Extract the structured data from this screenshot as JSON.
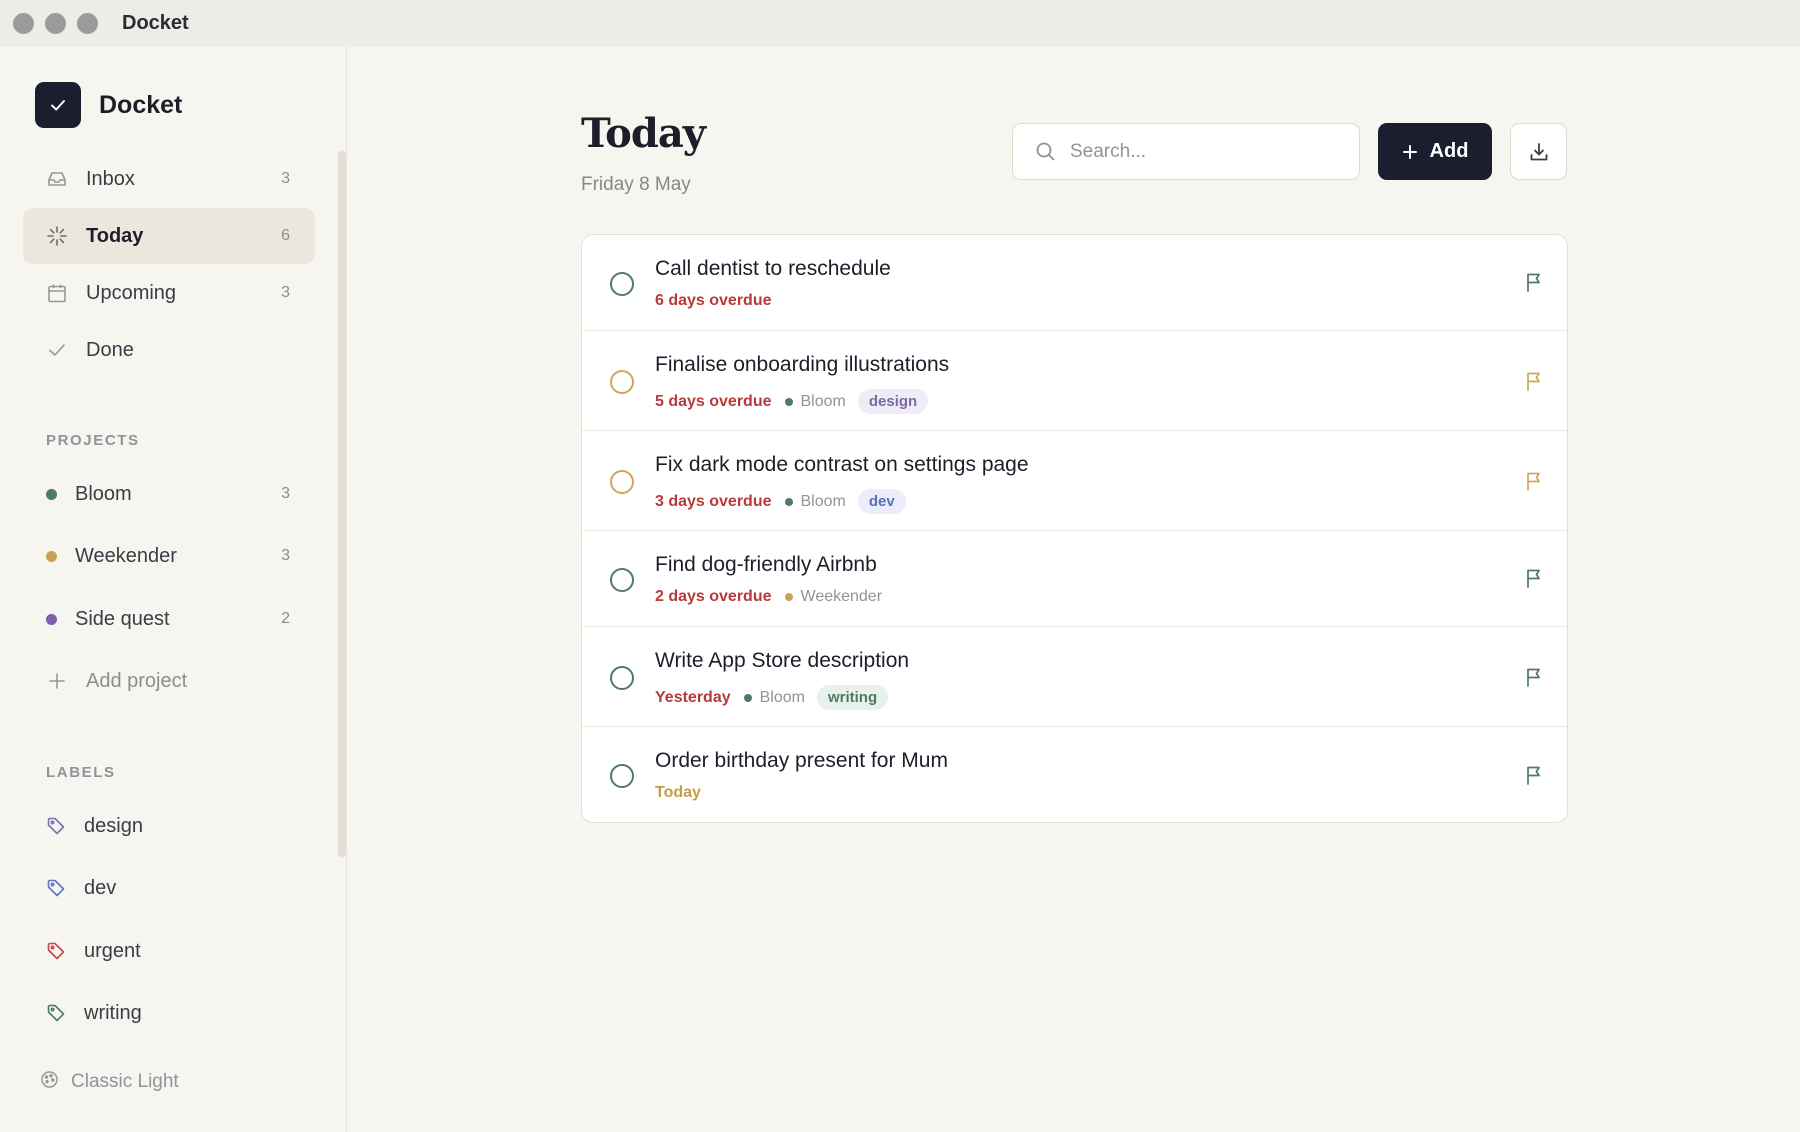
{
  "window": {
    "title": "Docket"
  },
  "colors": {
    "accent": "#1b1e2e",
    "overdue": "#b83a3a",
    "today": "#c79a4a",
    "bloom": "#4f7a64",
    "weekender": "#c9a257",
    "side_quest": "#7b5fb3"
  },
  "sidebar": {
    "brand": "Docket",
    "nav": [
      {
        "label": "Inbox",
        "count": "3",
        "icon": "inbox-icon"
      },
      {
        "label": "Today",
        "count": "6",
        "icon": "sparkle-icon"
      },
      {
        "label": "Upcoming",
        "count": "3",
        "icon": "calendar-icon"
      },
      {
        "label": "Done",
        "count": "",
        "icon": "check-icon"
      }
    ],
    "projects_heading": "PROJECTS",
    "projects": [
      {
        "label": "Bloom",
        "count": "3",
        "color": "#4f7a64"
      },
      {
        "label": "Weekender",
        "count": "3",
        "color": "#c9a257"
      },
      {
        "label": "Side quest",
        "count": "2",
        "color": "#7b5fb3"
      }
    ],
    "add_project": "Add project",
    "labels_heading": "LABELS",
    "labels": [
      {
        "label": "design",
        "color": "#7b70b0"
      },
      {
        "label": "dev",
        "color": "#6272c0"
      },
      {
        "label": "urgent",
        "color": "#c0474a"
      },
      {
        "label": "writing",
        "color": "#4f7a64"
      }
    ],
    "theme": "Classic Light"
  },
  "main": {
    "title": "Today",
    "date": "Friday 8 May",
    "search_placeholder": "Search...",
    "add_label": "Add",
    "tasks": [
      {
        "title": "Call dentist to reschedule",
        "due": "6 days overdue",
        "project": "",
        "tag": ""
      },
      {
        "title": "Finalise onboarding illustrations",
        "due": "5 days overdue",
        "project": "Bloom",
        "tag": "design"
      },
      {
        "title": "Fix dark mode contrast on settings page",
        "due": "3 days overdue",
        "project": "Bloom",
        "tag": "dev"
      },
      {
        "title": "Find dog-friendly Airbnb",
        "due": "2 days overdue",
        "project": "Weekender",
        "tag": ""
      },
      {
        "title": "Write App Store description",
        "due": "Yesterday",
        "project": "Bloom",
        "tag": "writing"
      },
      {
        "title": "Order birthday present for Mum",
        "due": "Today",
        "project": "",
        "tag": ""
      }
    ]
  }
}
